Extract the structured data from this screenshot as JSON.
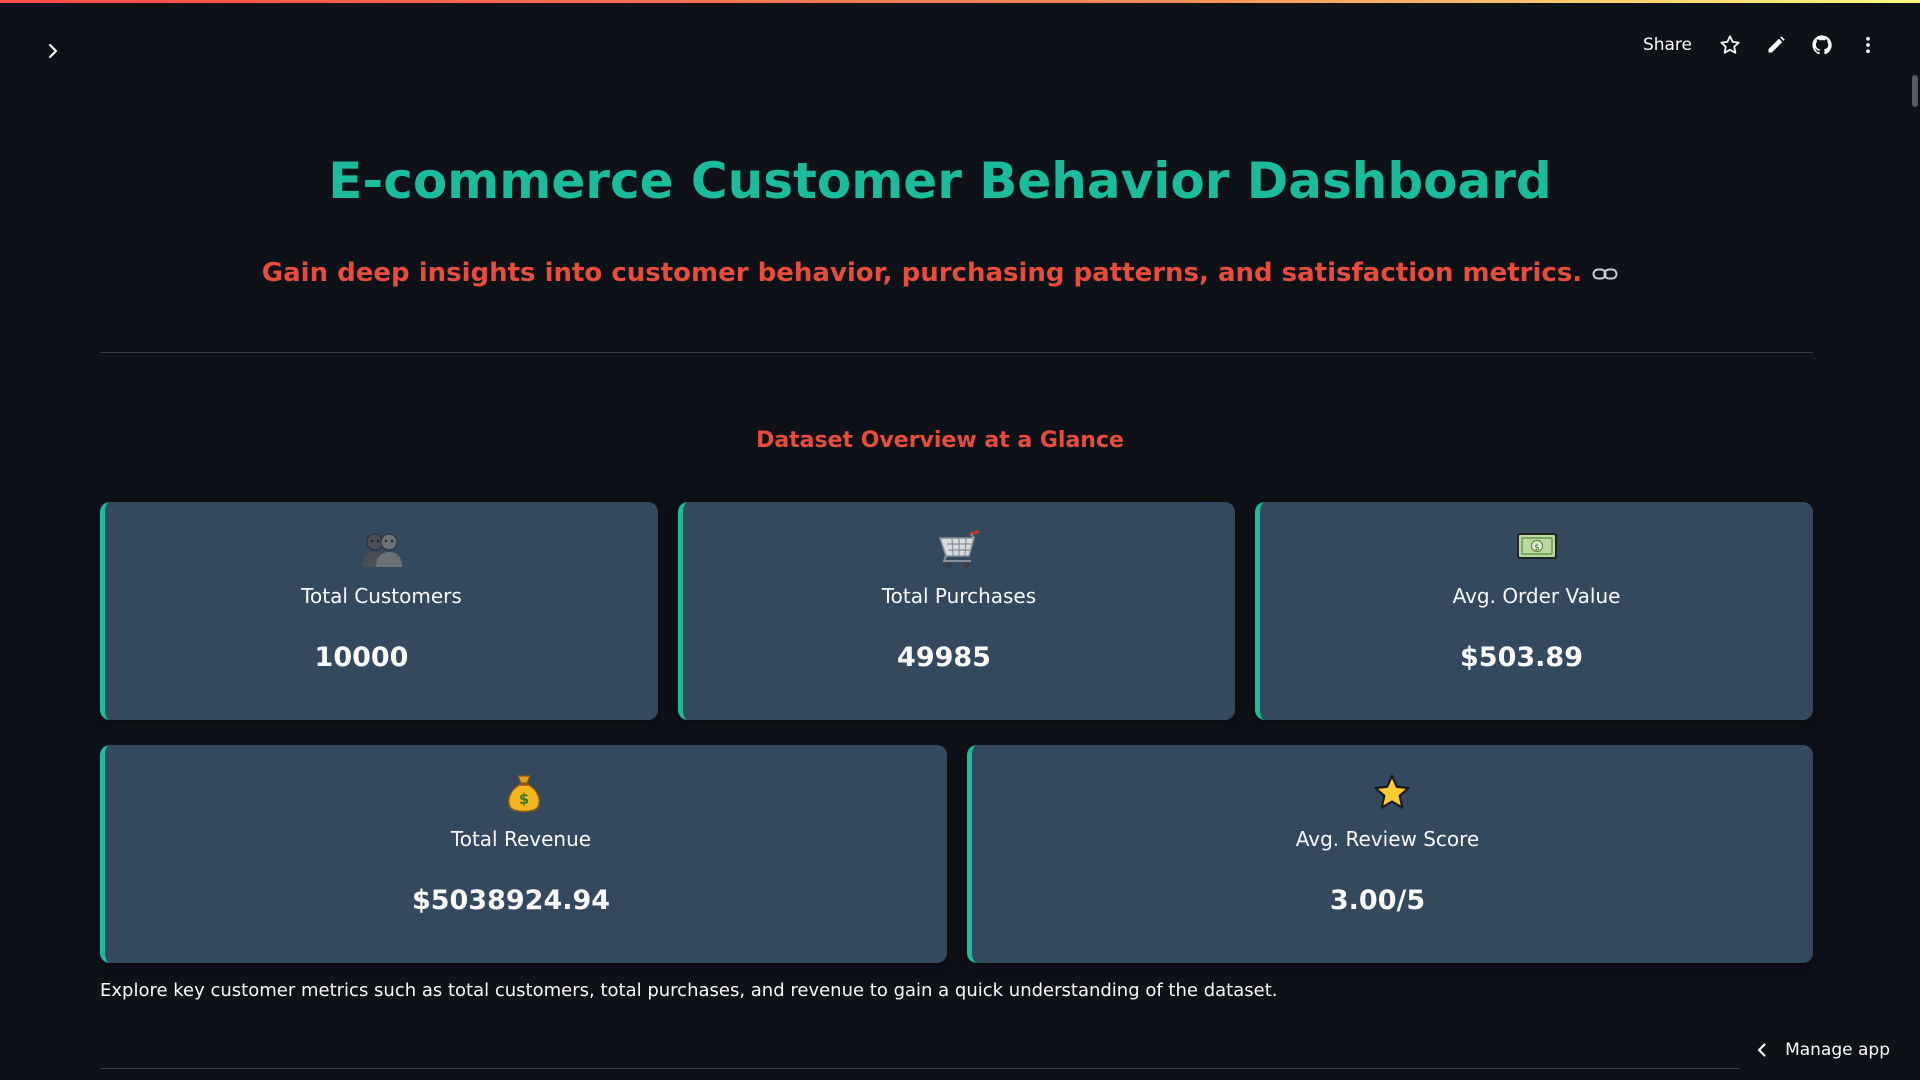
{
  "header": {
    "share_label": "Share",
    "icons": [
      "star-icon",
      "pencil-icon",
      "github-icon",
      "more-vertical-icon"
    ]
  },
  "page": {
    "title": "E-commerce Customer Behavior Dashboard",
    "subtitle": "Gain deep insights into customer behavior, purchasing patterns, and satisfaction metrics."
  },
  "overview": {
    "heading": "Dataset Overview at a Glance",
    "cards": [
      {
        "icon": "people-icon",
        "label": "Total Customers",
        "value": "10000"
      },
      {
        "icon": "shopping-cart-icon",
        "label": "Total Purchases",
        "value": "49985"
      },
      {
        "icon": "dollar-banknote-icon",
        "label": "Avg. Order Value",
        "value": "$503.89"
      },
      {
        "icon": "money-bag-icon",
        "label": "Total Revenue",
        "value": "$5038924.94"
      },
      {
        "icon": "star-icon",
        "label": "Avg. Review Score",
        "value": "3.00/5"
      }
    ],
    "caption": "Explore key customer metrics such as total customers, total purchases, and revenue to gain a quick understanding of the dataset."
  },
  "footer": {
    "manage_app_label": "Manage app"
  },
  "colors": {
    "background": "#0e1117",
    "title": "#1abc9c",
    "accent": "#e74c3c",
    "card": "#34495e",
    "card_border": "#1abc9c"
  }
}
